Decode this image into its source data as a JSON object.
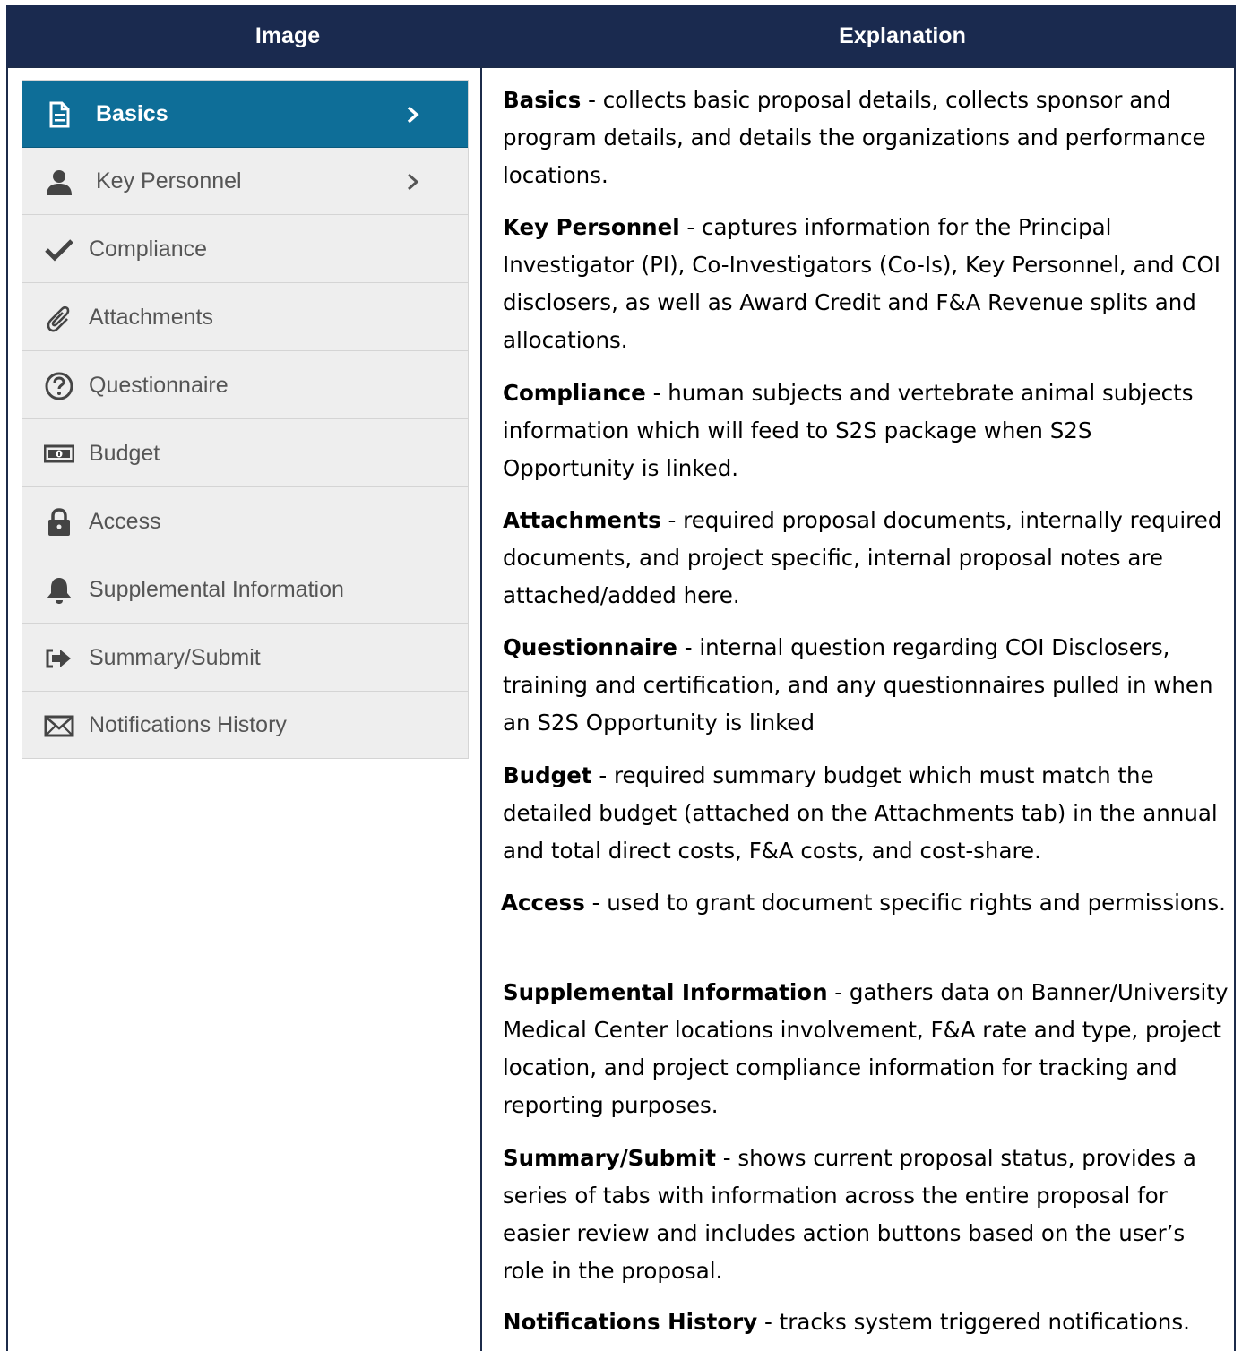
{
  "header": {
    "image_col": "Image",
    "explanation_col": "Explanation"
  },
  "menu": {
    "items": [
      {
        "label": "Basics",
        "icon": "document-icon",
        "active": true,
        "has_chevron": true
      },
      {
        "label": "Key Personnel",
        "icon": "user-icon",
        "active": false,
        "has_chevron": true
      },
      {
        "label": "Compliance",
        "icon": "checkmark-icon",
        "active": false,
        "has_chevron": false
      },
      {
        "label": "Attachments",
        "icon": "paperclip-icon",
        "active": false,
        "has_chevron": false
      },
      {
        "label": "Questionnaire",
        "icon": "question-circle-icon",
        "active": false,
        "has_chevron": false
      },
      {
        "label": "Budget",
        "icon": "money-icon",
        "active": false,
        "has_chevron": false
      },
      {
        "label": "Access",
        "icon": "lock-icon",
        "active": false,
        "has_chevron": false
      },
      {
        "label": "Supplemental Information",
        "icon": "bell-icon",
        "active": false,
        "has_chevron": false
      },
      {
        "label": "Summary/Submit",
        "icon": "sign-in-icon",
        "active": false,
        "has_chevron": false
      },
      {
        "label": "Notifications History",
        "icon": "envelope-icon",
        "active": false,
        "has_chevron": false
      }
    ],
    "colors": {
      "active_bg": "#0e6e98",
      "item_bg": "#eeeeee",
      "text": "#555555"
    }
  },
  "explanations": [
    {
      "term": "Basics",
      "text": " - collects basic proposal details, collects sponsor and program details, and details the organizations and performance locations."
    },
    {
      "term": "Key Personnel",
      "text": " - captures information for the Principal Investigator (PI), Co-Investigators (Co-Is), Key Personnel, and COI disclosers, as well as Award Credit and F&A Revenue splits and allocations."
    },
    {
      "term": "Compliance",
      "text": " - human subjects and vertebrate animal subjects information which will feed to S2S package when S2S Opportunity is linked."
    },
    {
      "term": "Attachments",
      "text": " - required proposal documents, internally required documents, and project specific, internal proposal notes are attached/added here."
    },
    {
      "term": "Questionnaire",
      "text": " - internal question regarding COI Disclosers, training and certification, and any questionnaires pulled in when an S2S Opportunity is linked"
    },
    {
      "term": "Budget",
      "text": " - required summary budget which must match the detailed budget (attached on the Attachments tab) in the annual and total direct costs, F&A costs, and cost-share."
    },
    {
      "term": "Access",
      "text": " - used to grant document specific rights and permissions."
    },
    {
      "term": "Supplemental Information",
      "text": " - gathers data on Banner/University Medical Center locations involvement, F&A rate and type, project location, and project compliance information for tracking and reporting purposes."
    },
    {
      "term": "Summary/Submit",
      "text": " - shows current proposal status, provides a series of tabs with information across the entire proposal for easier review and includes action buttons based on the user’s role in the proposal."
    },
    {
      "term": "Notifications History",
      "text": " - tracks system triggered notifications."
    }
  ],
  "header_color": "#1a2a4f"
}
